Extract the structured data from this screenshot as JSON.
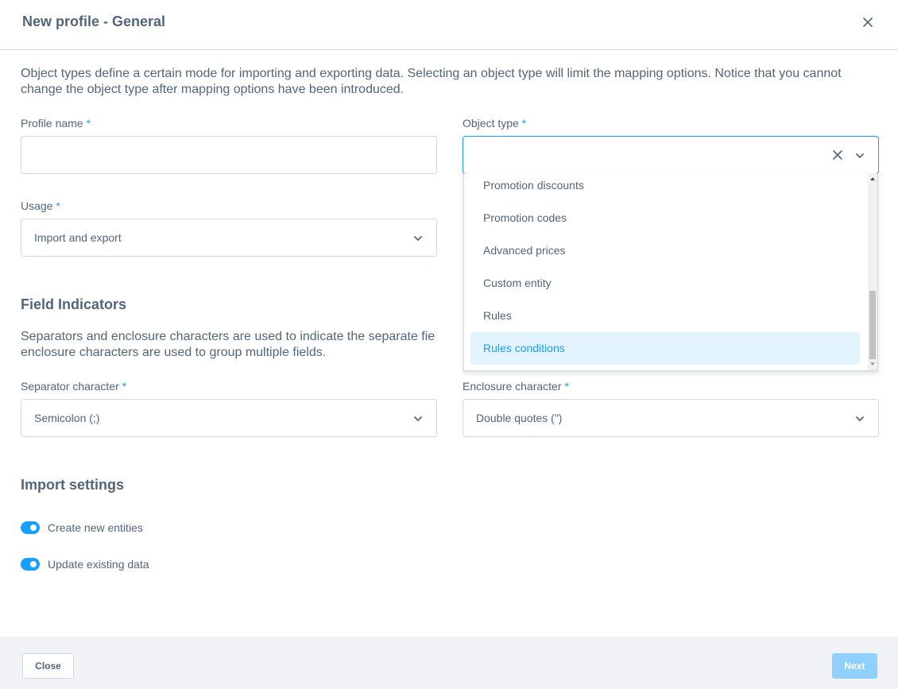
{
  "modal": {
    "title": "New profile - General"
  },
  "intro": "Object types define a certain mode for importing and exporting data. Selecting an object type will limit the mapping options. Notice that you cannot change the object type after mapping options have been introduced.",
  "profile_name": {
    "label": "Profile name",
    "required": "*",
    "value": ""
  },
  "object_type": {
    "label": "Object type",
    "required": "*",
    "value": "",
    "options": [
      "Promotion discounts",
      "Promotion codes",
      "Advanced prices",
      "Custom entity",
      "Rules",
      "Rules conditions"
    ],
    "highlighted": "Rules conditions"
  },
  "usage": {
    "label": "Usage",
    "required": "*",
    "value": "Import and export"
  },
  "field_indicators": {
    "title": "Field Indicators",
    "description_line1": "Separators and enclosure characters are used to indicate the separate fie",
    "description_line2": "enclosure characters are used to group multiple fields."
  },
  "separator": {
    "label": "Separator character",
    "required": "*",
    "value": "Semicolon (;)"
  },
  "enclosure": {
    "label": "Enclosure character",
    "required": "*",
    "value": "Double quotes (\")"
  },
  "import_settings": {
    "title": "Import settings",
    "create_new": {
      "label": "Create new entities",
      "enabled": true
    },
    "update_existing": {
      "label": "Update existing data",
      "enabled": true
    }
  },
  "footer": {
    "close_label": "Close",
    "next_label": "Next"
  },
  "colors": {
    "accent": "#189eff",
    "text": "#52667a",
    "border": "#d1d9e0",
    "footer_bg": "#f0f2f5",
    "highlight_bg": "#e3f3ff",
    "next_disabled": "#8fd0ff"
  }
}
